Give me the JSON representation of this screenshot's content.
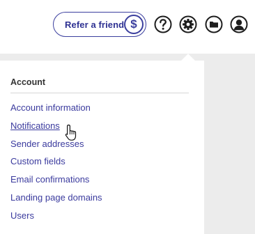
{
  "header": {
    "refer_label": "Refer a friend",
    "refer_icon": "$",
    "icons": [
      "help-icon",
      "gear-icon",
      "folder-icon",
      "user-account-icon"
    ]
  },
  "menu": {
    "section_title": "Account",
    "items": [
      {
        "label": "Account information"
      },
      {
        "label": "Notifications"
      },
      {
        "label": "Sender addresses"
      },
      {
        "label": "Custom fields"
      },
      {
        "label": "Email confirmations"
      },
      {
        "label": "Landing page domains"
      },
      {
        "label": "Users"
      }
    ],
    "hovered_item": "Notifications"
  },
  "colors": {
    "accent": "#3b3f9e",
    "link": "#3b3b9e",
    "background": "#ececec",
    "panel": "#ffffff"
  }
}
